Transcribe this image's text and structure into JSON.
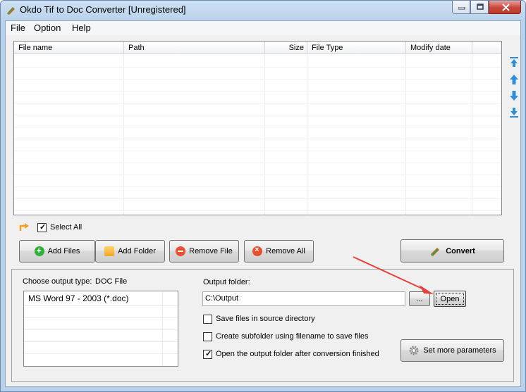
{
  "window": {
    "title": "Okdo Tif to Doc Converter [Unregistered]"
  },
  "menu": [
    "File",
    "Option",
    "Help"
  ],
  "columns": [
    "File name",
    "Path",
    "Size",
    "File Type",
    "Modify date"
  ],
  "select_all": {
    "label": "Select All",
    "checked": true
  },
  "buttons": {
    "add_files": "Add Files",
    "add_folder": "Add Folder",
    "remove_file": "Remove File",
    "remove_all": "Remove All",
    "convert": "Convert",
    "browse": "...",
    "open": "Open",
    "more_params": "Set more parameters"
  },
  "output": {
    "type_label": "Choose output type:",
    "type_value": "DOC File",
    "type_options": [
      "MS Word 97 - 2003 (*.doc)"
    ],
    "folder_label": "Output folder:",
    "folder_value": "C:\\Output"
  },
  "options": [
    {
      "label": "Save files in source directory",
      "checked": false
    },
    {
      "label": "Create subfolder using filename to save files",
      "checked": false
    },
    {
      "label": "Open the output folder after conversion finished",
      "checked": true
    }
  ],
  "colors": {
    "accent_blue": "#2e8fd8",
    "arrow_red": "#e8403a"
  }
}
